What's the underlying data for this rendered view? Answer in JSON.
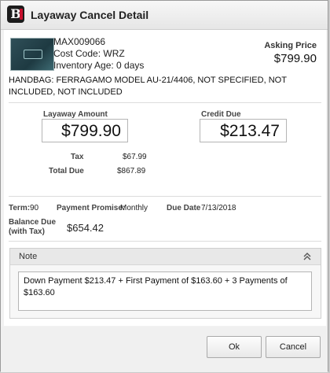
{
  "window": {
    "title": "Layaway Cancel Detail"
  },
  "item": {
    "sku": "MAX009066",
    "cost_code": "Cost Code: WRZ",
    "inventory_age": "Inventory Age: 0 days",
    "asking_price_label": "Asking Price",
    "asking_price": "$799.90",
    "description": "HANDBAG: FERRAGAMO MODEL AU-21/4406, NOT SPECIFIED, NOT INCLUDED, NOT INCLUDED",
    "thumbnail_icon": "handbag-thumbnail"
  },
  "amounts": {
    "layaway_label": "Layaway Amount",
    "layaway_value": "$799.90",
    "credit_label": "Credit Due",
    "credit_value": "$213.47",
    "tax_label": "Tax",
    "tax_value": "$67.99",
    "total_label": "Total Due",
    "total_value": "$867.89"
  },
  "terms": {
    "term_label": "Term:",
    "term_value": "90",
    "promise_label": "Payment Promise:",
    "promise_value": "Monthly",
    "due_label": "Due Date",
    "due_value": "7/13/2018",
    "balance_label_line1": "Balance Due",
    "balance_label_line2": "(with Tax)",
    "balance_value": "$654.42"
  },
  "note": {
    "header": "Note",
    "text": "Down Payment $213.47 + First Payment of $163.60 + 3 Payments of $163.60",
    "collapse_icon": "chevron-double-up-icon"
  },
  "buttons": {
    "ok": "Ok",
    "cancel": "Cancel"
  },
  "colors": {
    "logo_bg": "#1c1c1c",
    "logo_accent": "#c8102e"
  }
}
